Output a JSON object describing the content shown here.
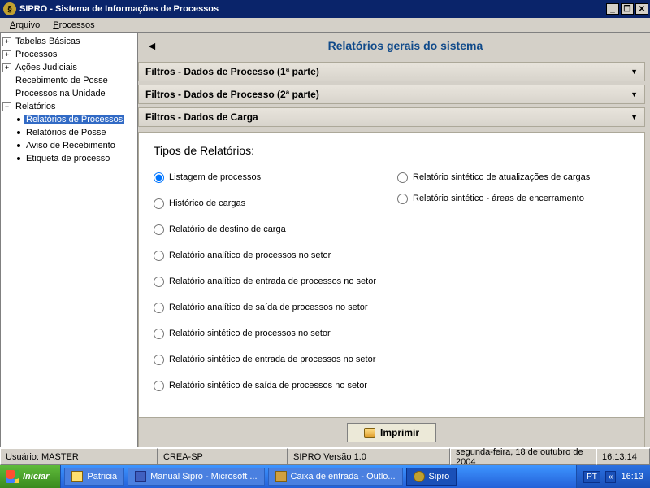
{
  "window": {
    "title": "SIPRO - Sistema de Informações de Processos"
  },
  "menu": {
    "arquivo": "Arquivo",
    "processos": "Processos"
  },
  "tree": {
    "n0": "Tabelas Básicas",
    "n1": "Processos",
    "n2": "Ações Judiciais",
    "n3": "Recebimento de Posse",
    "n4": "Processos na Unidade",
    "n5": "Relatórios",
    "c0": "Relatórios de Processos",
    "c1": "Relatórios de Posse",
    "c2": "Aviso de Recebimento",
    "c3": "Etiqueta de processo"
  },
  "header": {
    "back": "◄",
    "title": "Relatórios gerais do sistema"
  },
  "filters": {
    "f1": "Filtros - Dados de Processo (1ª parte)",
    "f2": "Filtros - Dados de Processo (2ª parte)",
    "f3": "Filtros - Dados de Carga"
  },
  "reports": {
    "heading": "Tipos de Relatórios:",
    "r0": "Listagem de processos",
    "r1": "Histórico de cargas",
    "r2": "Relatório de destino de carga",
    "r3": "Relatório analítico de processos no setor",
    "r4": "Relatório analítico de entrada de processos no setor",
    "r5": "Relatório analítico de saída de processos no setor",
    "r6": "Relatório sintético de processos no setor",
    "r7": "Relatório sintético de entrada de processos no setor",
    "r8": "Relatório sintético de saída de processos no setor",
    "r9": "Relatório sintético de atualizações de cargas",
    "r10": "Relatório sintético - áreas de encerramento",
    "print": "Imprimir"
  },
  "status": {
    "user_label": "Usuário:  MASTER",
    "org": "CREA-SP",
    "version": "SIPRO Versão 1.0",
    "date": "segunda-feira, 18 de outubro de 2004",
    "time": "16:13:14"
  },
  "taskbar": {
    "start": "Iniciar",
    "t0": "Patricia",
    "t1": "Manual Sipro - Microsoft ...",
    "t2": "Caixa de entrada - Outlo...",
    "t3": "Sipro",
    "lang": "PT",
    "chev": "«",
    "clock": "16:13"
  }
}
